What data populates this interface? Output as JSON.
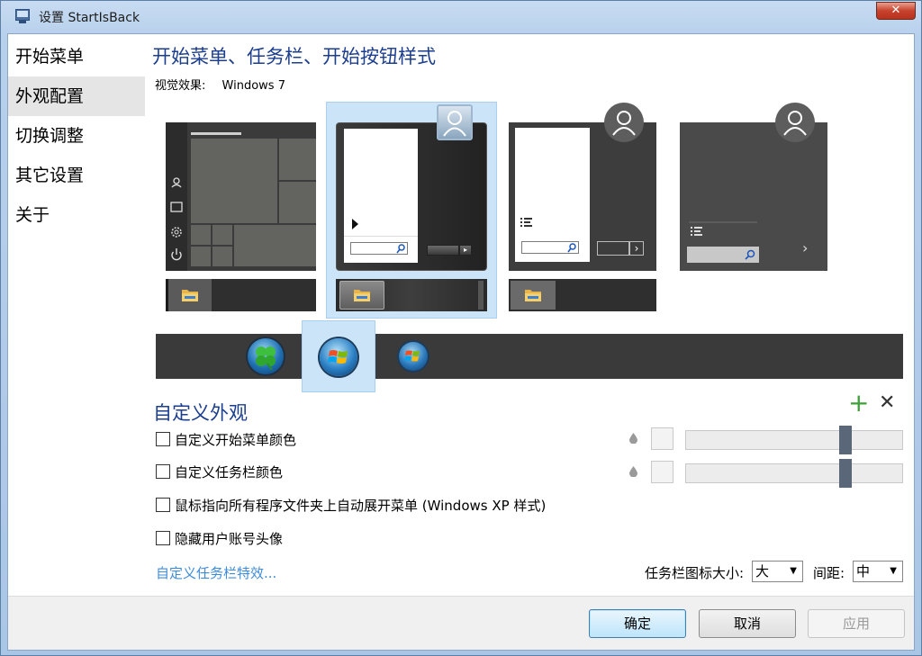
{
  "window": {
    "title": "设置 StartIsBack",
    "close_glyph": "✕"
  },
  "sidebar": {
    "items": [
      {
        "label": "开始菜单",
        "active": false
      },
      {
        "label": "外观配置",
        "active": true
      },
      {
        "label": "切换调整",
        "active": false
      },
      {
        "label": "其它设置",
        "active": false
      },
      {
        "label": "关于",
        "active": false
      }
    ]
  },
  "appearance": {
    "heading": "开始菜单、任务栏、开始按钮样式",
    "visual_label": "视觉效果:",
    "visual_value": "Windows 7",
    "selected_style_index": 1,
    "selected_orb_index": 1
  },
  "custom": {
    "heading": "自定义外观",
    "add_glyph": "+",
    "remove_glyph": "✕",
    "options": [
      {
        "label": "自定义开始菜单颜色",
        "checked": false
      },
      {
        "label": "自定义任务栏颜色",
        "checked": false
      },
      {
        "label": "鼠标指向所有程序文件夹上自动展开菜单 (Windows XP 样式)",
        "checked": false
      },
      {
        "label": "隐藏用户账号头像",
        "checked": false
      }
    ],
    "start_menu_color_level": 0.75,
    "taskbar_color_level": 0.75,
    "taskbar_effects_link": "自定义任务栏特效...",
    "icon_size_label": "任务栏图标大小:",
    "icon_size_value": "大",
    "spacing_label": "间距:",
    "spacing_value": "中",
    "dropdown_glyph": "▼"
  },
  "footer": {
    "ok": "确定",
    "cancel": "取消",
    "apply": "应用"
  },
  "colors": {
    "heading": "#1c3e8e",
    "link": "#3f8cd8",
    "selection": "#cbe4f8",
    "add": "#3ca036"
  }
}
